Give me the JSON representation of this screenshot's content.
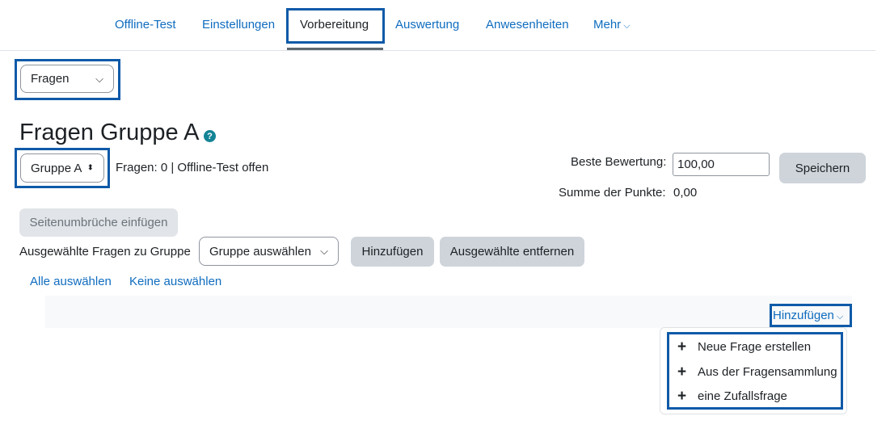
{
  "nav": {
    "tabs": [
      {
        "label": "Offline-Test"
      },
      {
        "label": "Einstellungen"
      },
      {
        "label": "Vorbereitung"
      },
      {
        "label": "Auswertung"
      },
      {
        "label": "Anwesenheiten"
      },
      {
        "label": "Mehr"
      }
    ]
  },
  "section_select": {
    "value": "Fragen"
  },
  "heading": {
    "title": "Fragen Gruppe A",
    "help_icon": "question-circle-icon"
  },
  "group_select": {
    "value": "Gruppe A"
  },
  "status": {
    "text": "Fragen: 0 | Offline-Test offen"
  },
  "grading": {
    "best_label": "Beste Bewertung:",
    "best_value": "100,00",
    "save_label": "Speichern",
    "sum_label": "Summe der Punkte:",
    "sum_value": "0,00"
  },
  "actions": {
    "page_breaks_label": "Seitenumbrüche einfügen",
    "selected_to_group_label": "Ausgewählte Fragen zu Gruppe",
    "group_choose_value": "Gruppe auswählen",
    "add_label": "Hinzufügen",
    "remove_selected_label": "Ausgewählte entfernen",
    "select_all": "Alle auswählen",
    "select_none": "Keine auswählen"
  },
  "add_menu": {
    "toggle_label": "Hinzufügen",
    "items": [
      {
        "label": "Neue Frage erstellen"
      },
      {
        "label": "Aus der Fragensammlung"
      },
      {
        "label": "eine Zufallsfrage"
      }
    ]
  },
  "colors": {
    "link": "#0f6cbf",
    "highlight": "#0f5aa8",
    "button": "#ced4da",
    "help": "#138496"
  }
}
